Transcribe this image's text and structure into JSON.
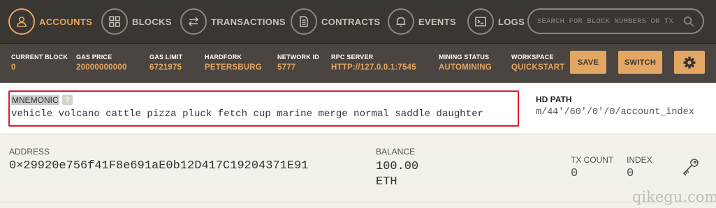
{
  "nav": {
    "items": [
      {
        "label": "ACCOUNTS",
        "icon": "user-icon",
        "active": true
      },
      {
        "label": "BLOCKS",
        "icon": "blocks-icon",
        "active": false
      },
      {
        "label": "TRANSACTIONS",
        "icon": "transactions-icon",
        "active": false
      },
      {
        "label": "CONTRACTS",
        "icon": "document-icon",
        "active": false
      },
      {
        "label": "EVENTS",
        "icon": "bell-icon",
        "active": false
      },
      {
        "label": "LOGS",
        "icon": "terminal-icon",
        "active": false
      }
    ],
    "search_placeholder": "SEARCH FOR BLOCK NUMBERS OR TX"
  },
  "status": {
    "current_block": {
      "label": "CURRENT BLOCK",
      "value": "0"
    },
    "gas_price": {
      "label": "GAS PRICE",
      "value": "20000000000"
    },
    "gas_limit": {
      "label": "GAS LIMIT",
      "value": "6721975"
    },
    "hardfork": {
      "label": "HARDFORK",
      "value": "PETERSBURG"
    },
    "network_id": {
      "label": "NETWORK ID",
      "value": "5777"
    },
    "rpc_server": {
      "label": "RPC SERVER",
      "value": "HTTP://127.0.0.1:7545"
    },
    "mining_status": {
      "label": "MINING STATUS",
      "value": "AUTOMINING"
    },
    "workspace": {
      "label": "WORKSPACE",
      "value": "QUICKSTART"
    },
    "save_label": "SAVE",
    "switch_label": "SWITCH"
  },
  "mnemonic": {
    "label": "MNEMONIC",
    "help": "?",
    "value": "vehicle volcano cattle pizza pluck fetch cup marine merge normal saddle daughter"
  },
  "hd_path": {
    "label": "HD PATH",
    "value": "m/44'/60'/0'/0/account_index"
  },
  "account": {
    "address_label": "ADDRESS",
    "address": "0×29920e756f41F8e691aE0b12D417C19204371E91",
    "balance_label": "BALANCE",
    "balance": "100.00\nETH",
    "tx_count_label": "TX COUNT",
    "tx_count": "0",
    "index_label": "INDEX",
    "index": "0"
  },
  "watermark": "qikegu.com",
  "colors": {
    "accent": "#e4a663",
    "nav_bg": "#3a3632",
    "status_bg": "#4a4540",
    "highlight_border": "#e3182d"
  }
}
